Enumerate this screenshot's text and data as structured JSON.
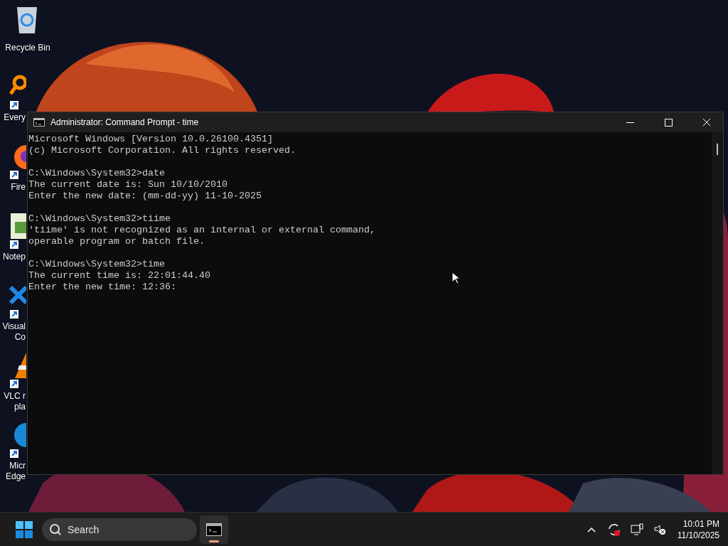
{
  "desktop_icons": [
    {
      "kind": "recycle",
      "shortcut": false,
      "label": [
        "Recycle Bin"
      ]
    },
    {
      "kind": "search",
      "shortcut": true,
      "label": [
        "Every"
      ]
    },
    {
      "kind": "browser",
      "shortcut": true,
      "label": [
        "Fire"
      ]
    },
    {
      "kind": "notepad",
      "shortcut": true,
      "label": [
        "Notep"
      ]
    },
    {
      "kind": "code",
      "shortcut": true,
      "label": [
        "Visual",
        "Co"
      ]
    },
    {
      "kind": "cone",
      "shortcut": true,
      "label": [
        "VLC r",
        "pla"
      ]
    },
    {
      "kind": "edge",
      "shortcut": true,
      "label": [
        "Micr",
        "Edge"
      ]
    }
  ],
  "window": {
    "title": "Administrator: Command Prompt - time",
    "console_blocks": [
      [
        "Microsoft Windows [Version 10.0.26100.4351]",
        "(c) Microsoft Corporation. All rights reserved."
      ],
      [
        "C:\\Windows\\System32>date",
        "The current date is: Sun 10/10/2010",
        "Enter the new date: (mm-dd-yy) 11-10-2025"
      ],
      [
        "C:\\Windows\\System32>tiime",
        "'tiime' is not recognized as an internal or external command,",
        "operable program or batch file."
      ],
      [
        "C:\\Windows\\System32>time",
        "The current time is: 22:01:44.40",
        "Enter the new time: 12:36:"
      ]
    ]
  },
  "taskbar": {
    "search": {
      "placeholder": "Search"
    },
    "apps": [
      {
        "kind": "terminal",
        "selected": true
      }
    ],
    "clock": {
      "time": "10:01 PM",
      "date": "11/10/2025"
    }
  }
}
